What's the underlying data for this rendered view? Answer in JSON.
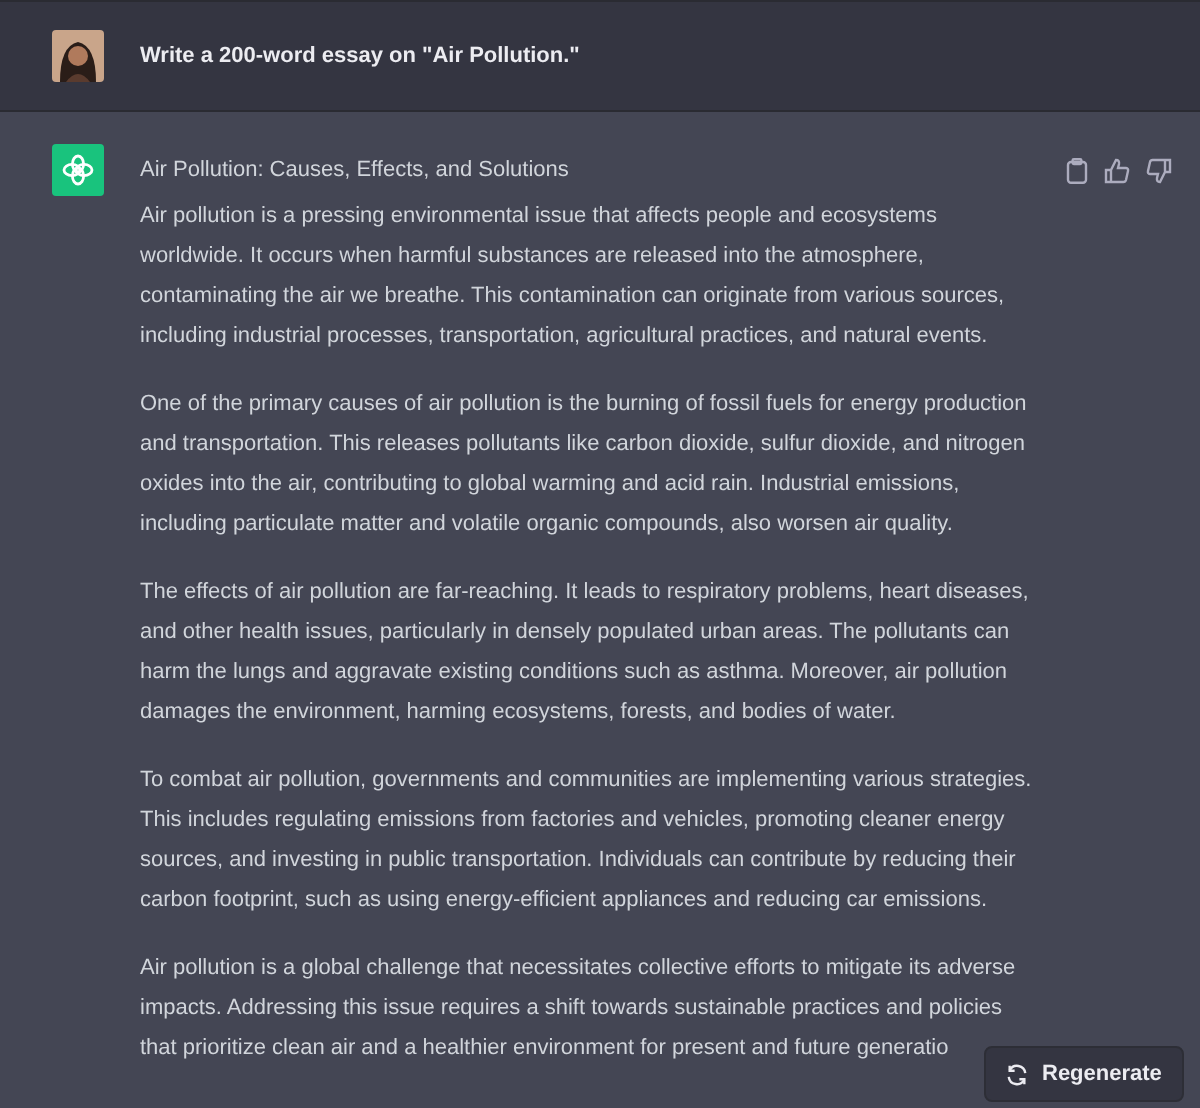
{
  "user_message": {
    "text": "Write a 200-word essay on \"Air Pollution.\""
  },
  "assistant_message": {
    "title": "Air Pollution: Causes, Effects, and Solutions",
    "paragraphs": [
      "Air pollution is a pressing environmental issue that affects people and ecosystems\nworldwide. It occurs when harmful substances are released into the atmosphere,\ncontaminating the air we breathe. This contamination can originate from various sources,\nincluding industrial processes, transportation, agricultural practices, and natural events.",
      "One of the primary causes of air pollution is the burning of fossil fuels for energy production\nand transportation. This releases pollutants like carbon dioxide, sulfur dioxide, and nitrogen\noxides into the air, contributing to global warming and acid rain. Industrial emissions,\nincluding particulate matter and volatile organic compounds, also worsen air quality.",
      "The effects of air pollution are far-reaching. It leads to respiratory problems, heart diseases,\nand other health issues, particularly in densely populated urban areas. The pollutants can\nharm the lungs and aggravate existing conditions such as asthma. Moreover, air pollution\ndamages the environment, harming ecosystems, forests, and bodies of water.",
      "To combat air pollution, governments and communities are implementing various strategies.\nThis includes regulating emissions from factories and vehicles, promoting cleaner energy\nsources, and investing in public transportation. Individuals can contribute by reducing their\ncarbon footprint, such as using energy-efficient appliances and reducing car emissions.",
      "Air pollution is a global challenge that necessitates collective efforts to mitigate its adverse\nimpacts. Addressing this issue requires a shift towards sustainable practices and policies\nthat prioritize clean air and a healthier environment for present and future generatio"
    ]
  },
  "regenerate_button": {
    "label": "Regenerate"
  }
}
